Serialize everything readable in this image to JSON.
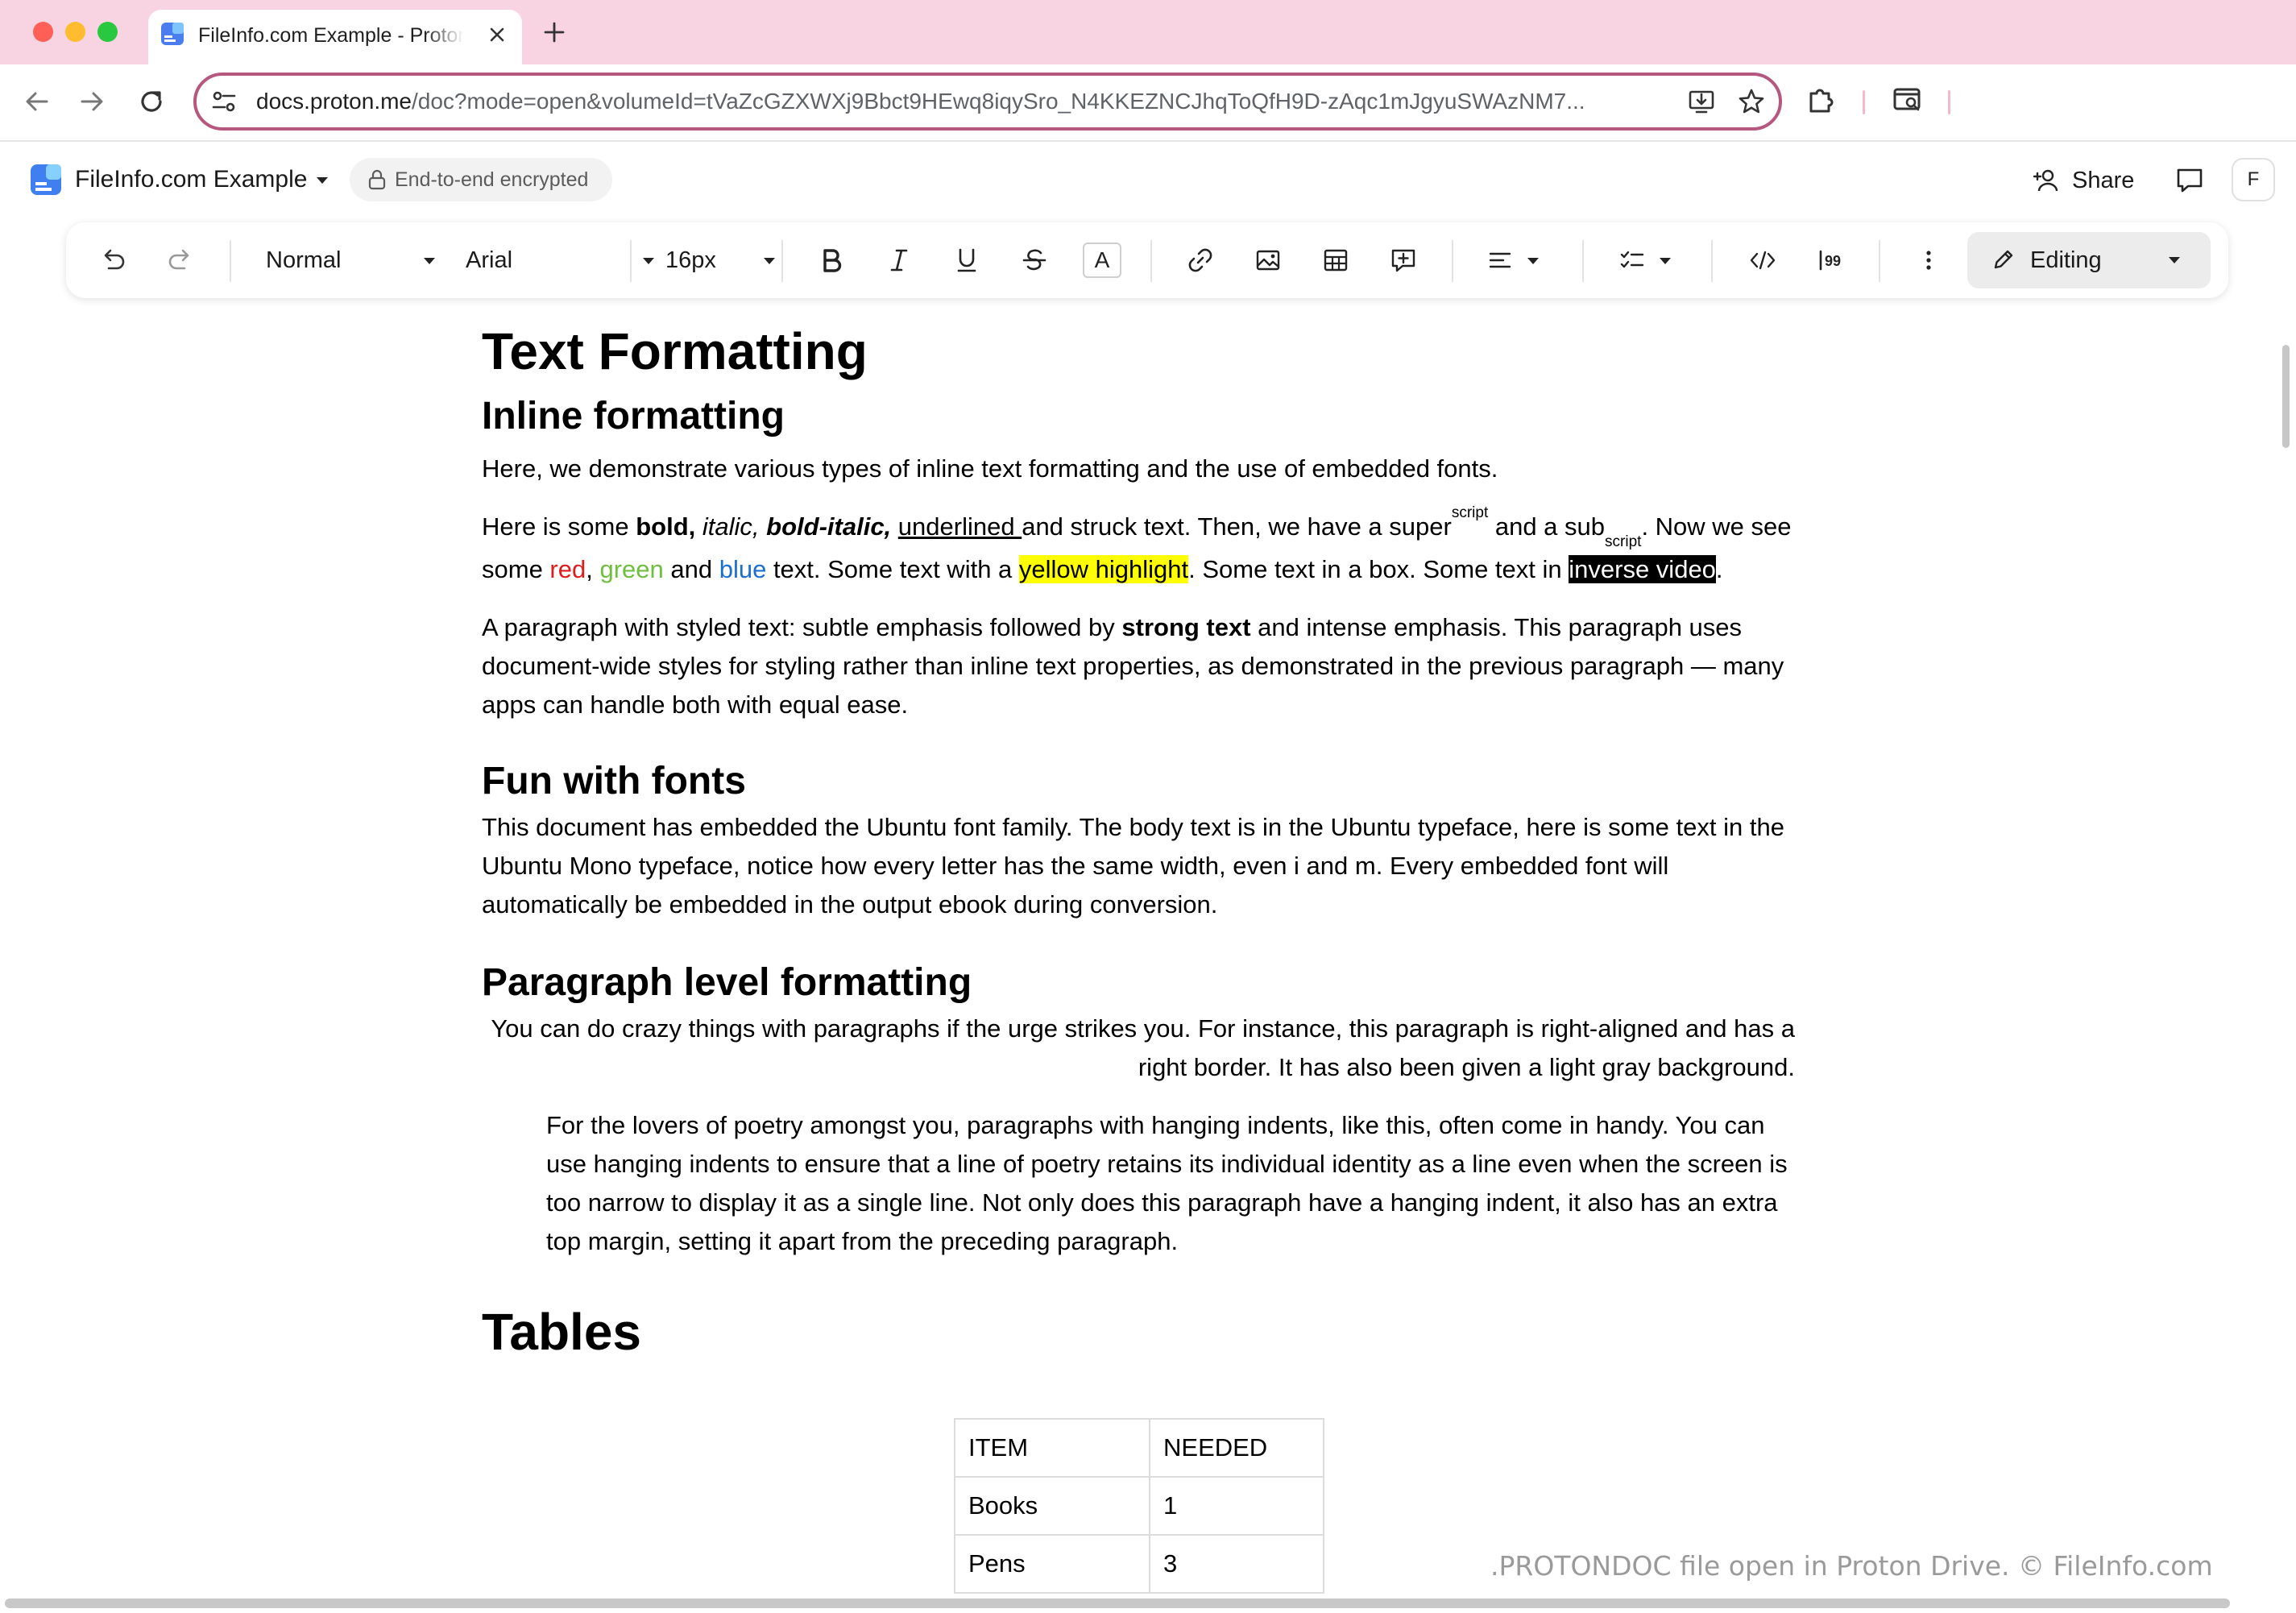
{
  "browser": {
    "tab_title": "FileInfo.com Example - Proton Docs",
    "url_host": "docs.proton.me",
    "url_path": "/doc?mode=open&volumeId=tVaZcGZXWXj9Bbct9HEwq8iqySro_N4KKEZNCJhqToQfH9D-zAqc1mJgyuSWAzNM7..."
  },
  "app": {
    "doc_name": "FileInfo.com Example",
    "encryption_label": "End-to-end encrypted",
    "share_label": "Share",
    "avatar_initial": "F"
  },
  "toolbar": {
    "block_style": "Normal",
    "font_family": "Arial",
    "font_size": "16px",
    "text_color_letter": "A",
    "mode_label": "Editing"
  },
  "doc": {
    "title": "Text Formatting",
    "inline_heading": "Inline formatting",
    "intro": "Here, we demonstrate various types of inline text formatting and the use of embedded fonts.",
    "p2": {
      "t1": "Here is some ",
      "bold": "bold,",
      "t2": " ",
      "italic": "italic,",
      "t3": " ",
      "bold_italic": "bold-italic,",
      "t4": " ",
      "underlined": "underlined ",
      "t5": "and struck text. Then, we have a super",
      "sup": "script",
      "t6": " and a sub",
      "sub": "script",
      "t7": ". Now we see some ",
      "red": "red",
      "t8": ", ",
      "green": "green",
      "t9": " and ",
      "blue": "blue",
      "t10": " text. Some text with a ",
      "highlight": "yellow highlight",
      "t11": ". Some text in a box. Some text in ",
      "inverse": "inverse video",
      "t12": "."
    },
    "p3": {
      "t1": "A paragraph with styled text: subtle emphasis followed by ",
      "strong": "strong text",
      "t2": " and intense emphasis. This paragraph uses document-wide styles for styling rather than inline text properties, as demonstrated in the previous paragraph — many apps can handle both with equal ease."
    },
    "fonts_heading": "Fun with fonts",
    "fonts_para": "This document has embedded the Ubuntu font family. The body text is in the Ubuntu typeface, here is some text in the Ubuntu Mono typeface, notice how every letter has the same width, even i and m. Every embedded font will automatically be embedded in the output ebook during conversion.",
    "para_heading": "Paragraph level formatting",
    "right_para": "You can do crazy things with paragraphs if the urge strikes you. For instance, this paragraph is right-aligned and has a right border. It has also been given a light gray background.",
    "hanging_para": "For the lovers of poetry amongst you, paragraphs with hanging indents, like this, often come in handy. You can use hanging indents to ensure that a line of poetry retains its individual identity as a line even when the screen is too narrow to display it as a single line. Not only does this paragraph have a hanging indent, it also has an extra top margin, setting it apart from the preceding paragraph.",
    "tables_heading": "Tables",
    "table": {
      "header": [
        "ITEM",
        "NEEDED"
      ],
      "rows": [
        [
          "Books",
          "1"
        ],
        [
          "Pens",
          "3"
        ]
      ]
    }
  },
  "watermark": ".PROTONDOC file open in Proton Drive. © FileInfo.com",
  "colors": {
    "tab_bar": "#f8d3e1",
    "omnibox_border": "#b5577e",
    "text_red": "#e01b1b",
    "text_green": "#6fbf3f",
    "text_blue": "#1c6fd1",
    "highlight": "#ffff00"
  }
}
